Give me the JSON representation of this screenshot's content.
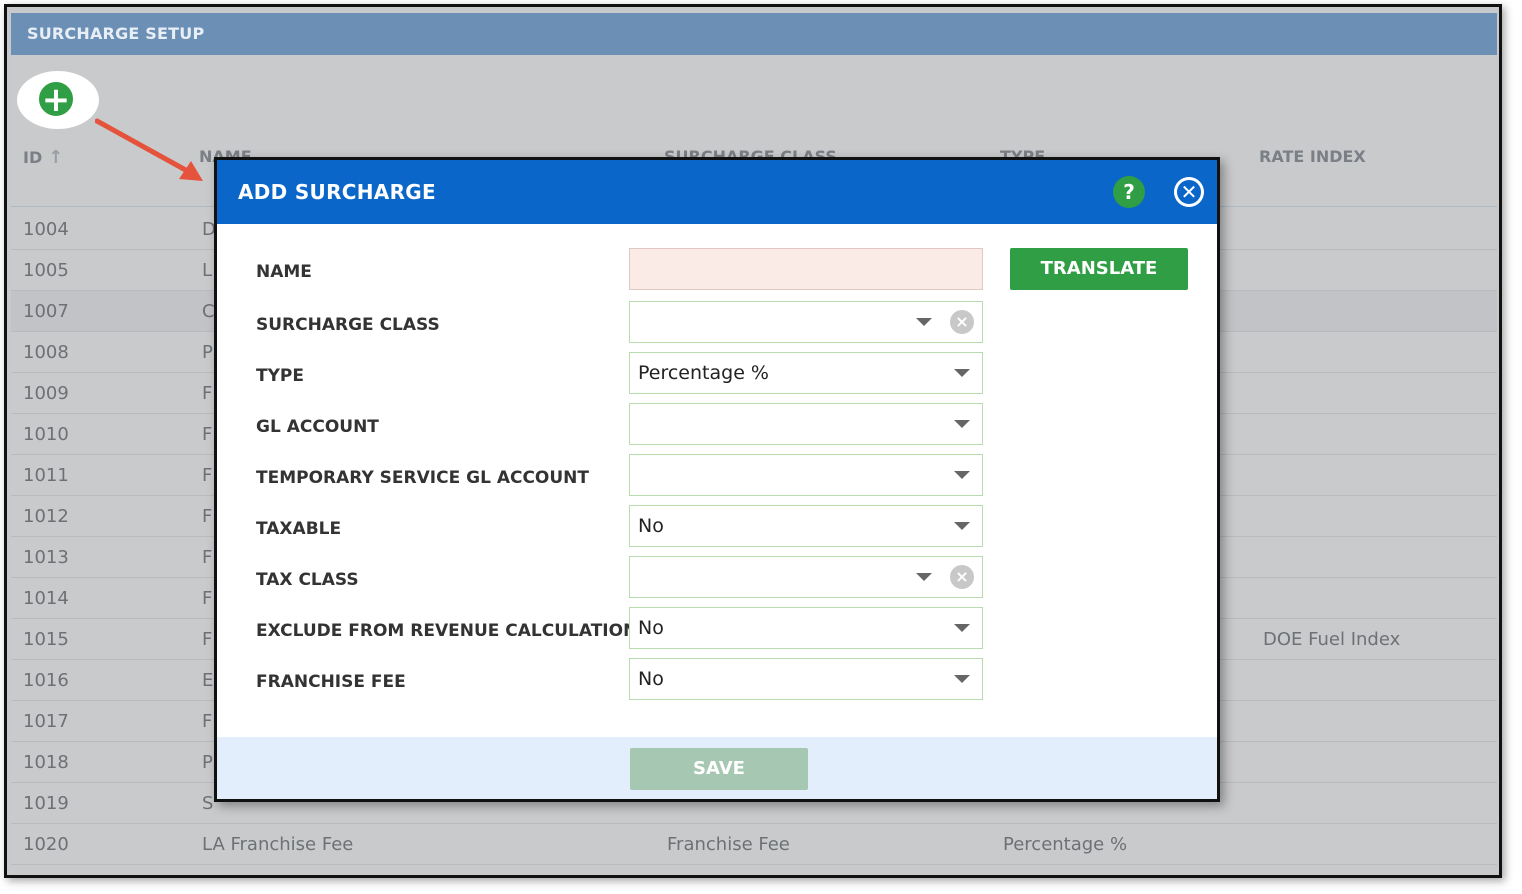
{
  "panel": {
    "title": "SURCHARGE SETUP",
    "add_icon": "plus-circle-icon",
    "columns": {
      "id": "ID",
      "name": "NAME",
      "surcharge_class": "SURCHARGE CLASS",
      "type": "TYPE",
      "rate_index": "RATE INDEX"
    },
    "rows": [
      {
        "id": "1004",
        "name": "D",
        "class": "",
        "type": "",
        "rate": ""
      },
      {
        "id": "1005",
        "name": "L",
        "class": "",
        "type": "",
        "rate": ""
      },
      {
        "id": "1007",
        "name": "C",
        "class": "",
        "type": "",
        "rate": ""
      },
      {
        "id": "1008",
        "name": "P",
        "class": "",
        "type": "",
        "rate": ""
      },
      {
        "id": "1009",
        "name": "F",
        "class": "",
        "type": "",
        "rate": ""
      },
      {
        "id": "1010",
        "name": "F",
        "class": "",
        "type": "",
        "rate": ""
      },
      {
        "id": "1011",
        "name": "F",
        "class": "",
        "type": "",
        "rate": ""
      },
      {
        "id": "1012",
        "name": "F",
        "class": "",
        "type": "",
        "rate": ""
      },
      {
        "id": "1013",
        "name": "F",
        "class": "",
        "type": "",
        "rate": ""
      },
      {
        "id": "1014",
        "name": "F",
        "class": "",
        "type": "",
        "rate": ""
      },
      {
        "id": "1015",
        "name": "F",
        "class": "",
        "type": "",
        "rate": "DOE Fuel Index"
      },
      {
        "id": "1016",
        "name": "E",
        "class": "",
        "type": "",
        "rate": ""
      },
      {
        "id": "1017",
        "name": "F",
        "class": "",
        "type": "",
        "rate": ""
      },
      {
        "id": "1018",
        "name": "P",
        "class": "",
        "type": "",
        "rate": ""
      },
      {
        "id": "1019",
        "name": "S",
        "class": "",
        "type": "",
        "rate": ""
      },
      {
        "id": "1020",
        "name": "LA Franchise Fee",
        "class": "Franchise Fee",
        "type": "Percentage %",
        "rate": ""
      }
    ]
  },
  "modal": {
    "title": "ADD SURCHARGE",
    "help_label": "?",
    "close_label": "✕",
    "translate_label": "TRANSLATE",
    "save_label": "SAVE",
    "fields": {
      "name": {
        "label": "NAME",
        "value": ""
      },
      "surcharge_class": {
        "label": "SURCHARGE CLASS",
        "value": ""
      },
      "type": {
        "label": "TYPE",
        "value": "Percentage %"
      },
      "gl_account": {
        "label": "GL ACCOUNT",
        "value": ""
      },
      "temp_gl_account": {
        "label": "TEMPORARY SERVICE GL ACCOUNT",
        "value": ""
      },
      "taxable": {
        "label": "TAXABLE",
        "value": "No"
      },
      "tax_class": {
        "label": "TAX CLASS",
        "value": ""
      },
      "exclude_revenue": {
        "label": "EXCLUDE FROM REVENUE CALCULATION",
        "value": "No"
      },
      "franchise_fee": {
        "label": "FRANCHISE FEE",
        "value": "No"
      }
    }
  },
  "colors": {
    "panel_header": "#6c8fb5",
    "modal_header": "#0a66c9",
    "green_button": "#2f9e44",
    "save_disabled": "#a6c8b2",
    "arrow": "#e5533d"
  }
}
